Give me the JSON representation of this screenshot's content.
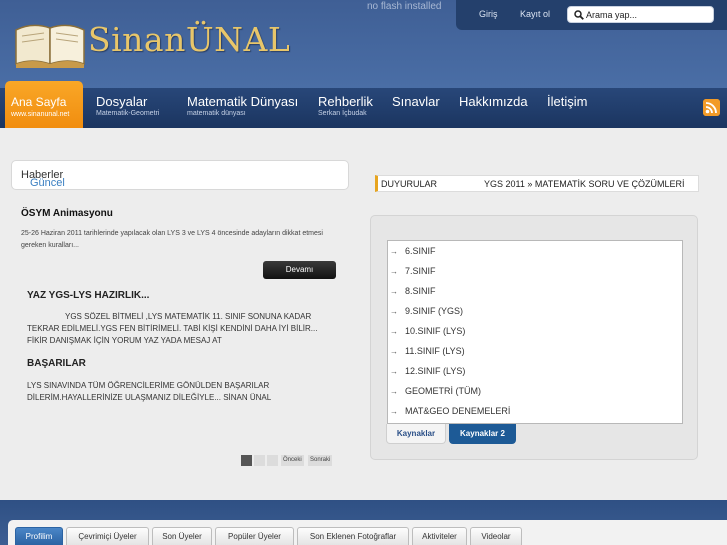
{
  "header": {
    "site_name": "SinanÜNAL",
    "flash_notice": "no flash installed",
    "login": "Giriş",
    "register": "Kayıt ol",
    "search_placeholder": "Arama yap..."
  },
  "nav": {
    "items": [
      {
        "label": "Ana Sayfa",
        "sub": "www.sinanunal.net"
      },
      {
        "label": "Dosyalar",
        "sub": "Matematik-Geometri"
      },
      {
        "label": "Matematik Dünyası",
        "sub": "matematik dünyası"
      },
      {
        "label": "Rehberlik",
        "sub": "Serkan İçbudak"
      },
      {
        "label": "Sınavlar",
        "sub": ""
      },
      {
        "label": "Hakkımızda",
        "sub": ""
      },
      {
        "label": "İletişim",
        "sub": ""
      }
    ]
  },
  "news": {
    "head_a": "Güncel",
    "head_b": " Haberler",
    "item_title": "ÖSYM Animasyonu",
    "item_text": "25-26 Haziran 2011 tarihlerinde yapılacak olan LYS 3 ve LYS 4 öncesinde adayların dikkat etmesi gereken kuralları...",
    "read_more": "Devamı",
    "prep_title": "YAZ YGS-LYS HAZIRLIK...",
    "prep_text": "YGS SÖZEL BİTMELİ ,LYS MATEMATİK 11. SINIF SONUNA KADAR TEKRAR EDİLMELİ.YGS FEN BİTİRİMELİ. TABİ KİŞİ KENDİNİ DAHA İYİ BİLİR... FİKİR  DANIŞMAK İÇİN YORUM YAZ YADA MESAJ AT",
    "success_title": "BAŞARILAR",
    "success_text": "LYS SINAVINDA TÜM ÖĞRENCİLERİME GÖNÜLDEN BAŞARILAR DİLERİM.HAYALLERİNİZE ULAŞMANIZ DİLEĞİYLE...    SİNAN ÜNAL",
    "prev": "Önceki",
    "next": "Sonraki"
  },
  "announcements": {
    "label": "DUYURULAR",
    "message": "YGS 2011 » MATEMATİK SORU VE ÇÖZÜMLERİ"
  },
  "resources": {
    "items": [
      "6.SINIF",
      "7.SINIF",
      "8.SINIF",
      "9.SINIF (YGS)",
      "10.SINIF (LYS)",
      "11.SINIF (LYS)",
      "12.SINIF (LYS)",
      "GEOMETRİ (TÜM)",
      "MAT&GEO DENEMELERİ"
    ],
    "tab1": "Kaynaklar",
    "tab2": "Kaynaklar 2"
  },
  "footer_tabs": [
    "Profilim",
    "Çevrimiçi Üyeler",
    "Son Üyeler",
    "Popüler Üyeler",
    "Son Eklenen Fotoğraflar",
    "Aktiviteler",
    "Videolar"
  ],
  "colors": {
    "accent": "#f29b28",
    "brand": "#3a5a8f",
    "nav": "#1b3560"
  }
}
